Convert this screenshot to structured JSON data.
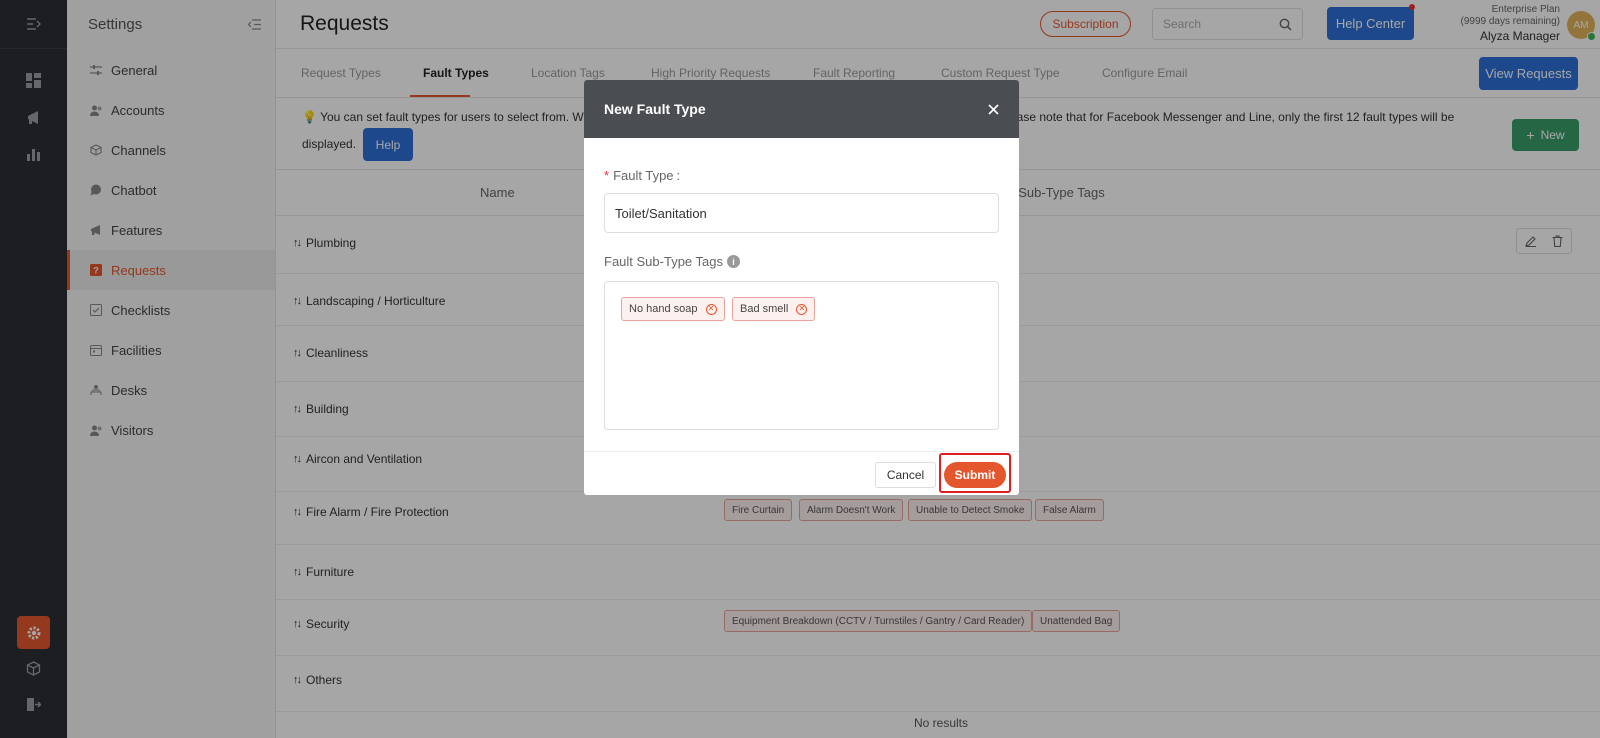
{
  "sidebar": {
    "title": "Settings",
    "items": [
      {
        "label": "General"
      },
      {
        "label": "Accounts"
      },
      {
        "label": "Channels"
      },
      {
        "label": "Chatbot"
      },
      {
        "label": "Features"
      },
      {
        "label": "Requests"
      },
      {
        "label": "Checklists"
      },
      {
        "label": "Facilities"
      },
      {
        "label": "Desks"
      },
      {
        "label": "Visitors"
      }
    ]
  },
  "header": {
    "title": "Requests",
    "subscription": "Subscription",
    "search_placeholder": "Search",
    "help_center": "Help Center",
    "plan_name": "Enterprise Plan",
    "plan_remaining": "(9999 days remaining)",
    "user_name": "Alyza Manager",
    "avatar_initials": "AM"
  },
  "tabs": [
    {
      "label": "Request Types"
    },
    {
      "label": "Fault Types"
    },
    {
      "label": "Location Tags"
    },
    {
      "label": "High Priority Requests"
    },
    {
      "label": "Fault Reporting"
    },
    {
      "label": "Custom Request Type"
    },
    {
      "label": "Configure Email"
    }
  ],
  "view_requests": "View Requests",
  "info": {
    "left_text": "You can set fault types for users to select from. We h",
    "right_text": "ease note that for Facebook Messenger and Line, only the first 12 fault types will be",
    "displayed": "displayed.",
    "help": "Help",
    "new_button": "New"
  },
  "table": {
    "col_name": "Name",
    "col_tags": "t Sub-Type Tags",
    "rows": [
      {
        "name": "Plumbing"
      },
      {
        "name": "Landscaping / Horticulture"
      },
      {
        "name": "Cleanliness"
      },
      {
        "name": "Building"
      },
      {
        "name": "Aircon and Ventilation"
      },
      {
        "name": "Fire Alarm / Fire Protection"
      },
      {
        "name": "Furniture"
      },
      {
        "name": "Security"
      },
      {
        "name": "Others"
      }
    ],
    "fire_tags": [
      "Fire Curtain",
      "Alarm Doesn't Work",
      "Unable to Detect Smoke",
      "False Alarm"
    ],
    "security_tags": [
      "Equipment Breakdown (CCTV / Turnstiles / Gantry / Card Reader)",
      "Unattended Bag"
    ],
    "no_results": "No results"
  },
  "modal": {
    "title": "New Fault Type",
    "fault_type_label": "Fault Type",
    "fault_type_value": "Toilet/Sanitation",
    "sub_type_label": "Fault Sub-Type Tags",
    "tags": [
      "No hand soap",
      "Bad smell"
    ],
    "cancel": "Cancel",
    "submit": "Submit"
  },
  "colors": {
    "accent": "#e4572e",
    "primary": "#2f6fd8",
    "success": "#3a9e6a",
    "highlight": "#e02020"
  }
}
